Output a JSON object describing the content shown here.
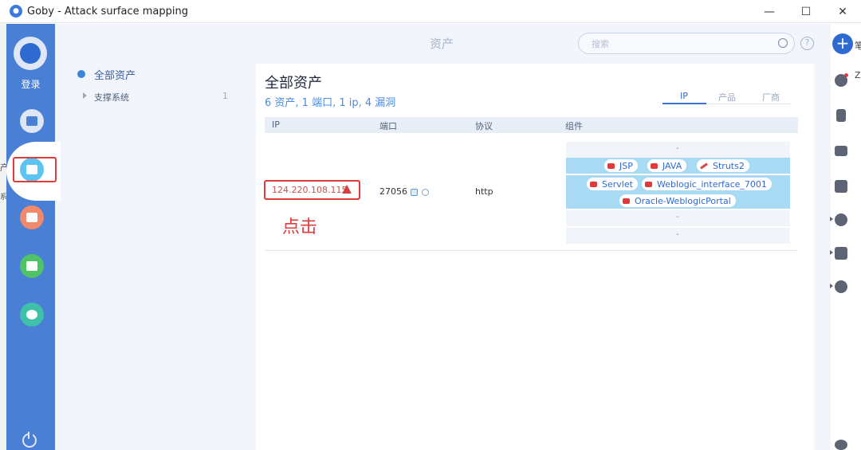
{
  "window": {
    "title": "Goby - Attack surface mapping",
    "minimize": "—",
    "maximize": "☐",
    "close": "✕"
  },
  "left_edge": {
    "text_top": "产",
    "text_bottom": "系"
  },
  "sidebar": {
    "login_label": "登录",
    "items": [
      {
        "name": "scan",
        "color": "#dfe7f6",
        "inner": "#4a7fd6"
      },
      {
        "name": "assets",
        "color": "#5bc4f0",
        "inner": "#ffffff"
      },
      {
        "name": "vulnerabilities",
        "color": "#f2896a",
        "inner": "#ffffff"
      },
      {
        "name": "report",
        "color": "#4fc466",
        "inner": "#ffffff"
      },
      {
        "name": "plugins",
        "color": "#3fc0a8",
        "inner": "#ffffff"
      }
    ]
  },
  "header": {
    "title": "资产",
    "search_placeholder": "搜索",
    "help": "?"
  },
  "tree": {
    "root_label": "全部资产",
    "children": [
      {
        "label": "支撑系统",
        "count": "1"
      }
    ]
  },
  "content": {
    "title": "全部资产",
    "summary": "6 资产, 1 端口, 1 ip, 4 漏洞",
    "tabs": [
      {
        "label": "IP",
        "active": true
      },
      {
        "label": "产品",
        "active": false
      },
      {
        "label": "厂商",
        "active": false
      }
    ],
    "columns": [
      "IP",
      "端口",
      "协议",
      "组件"
    ],
    "row": {
      "ip": "124.220.108.115",
      "port": "27056",
      "protocol": "http",
      "annotation": "点击",
      "components": {
        "empty_marker": "-",
        "chips": [
          "JSP",
          "JAVA",
          "Struts2",
          "Servlet",
          "Weblogic_interface_7001",
          "Oracle-WeblogicPortal"
        ]
      }
    }
  },
  "right_bar": {
    "add_label": "+",
    "edge_text_top": "笔",
    "edge_text_2": "Z"
  },
  "colors": {
    "sidebar": "#4a7fd6",
    "accent": "#2f6ad1",
    "highlight": "#e03a3a",
    "component_highlight": "#a9daf3"
  }
}
